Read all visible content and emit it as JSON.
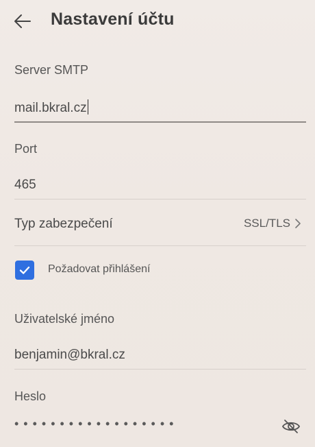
{
  "appbar": {
    "title": "Nastavení účtu",
    "back_icon": "arrow-left-icon"
  },
  "smtp": {
    "label": "Server SMTP",
    "value": "mail.bkral.cz"
  },
  "port": {
    "label": "Port",
    "value": "465"
  },
  "security": {
    "label": "Typ zabezpečení",
    "value": "SSL/TLS",
    "icon": "chevron-right-icon"
  },
  "require_login": {
    "label": "Požadovat přihlášení",
    "checked": true,
    "accent_color": "#2f6fe0"
  },
  "username": {
    "label": "Uživatelské jméno",
    "value": "benjamin@bkral.cz"
  },
  "password": {
    "label": "Heslo",
    "masked_value": "••••••••••••••••••",
    "visibility_icon": "eye-off-icon"
  }
}
